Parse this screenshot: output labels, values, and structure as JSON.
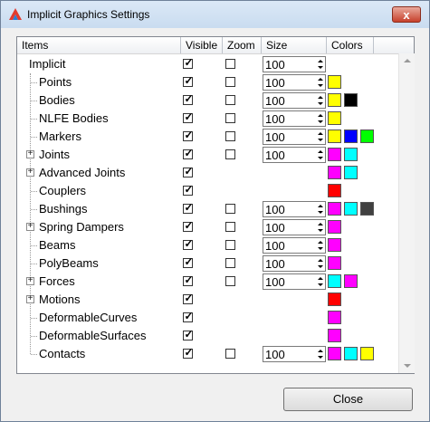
{
  "window": {
    "title": "Implicit Graphics Settings",
    "close_glyph": "x"
  },
  "columns": [
    "Items",
    "Visible",
    "Zoom",
    "Size",
    "Colors"
  ],
  "rows": [
    {
      "label": "Implicit",
      "indent": 0,
      "expandable": false,
      "visible": true,
      "zoom": false,
      "size": "100",
      "colors": []
    },
    {
      "label": "Points",
      "indent": 1,
      "expandable": false,
      "visible": true,
      "zoom": false,
      "size": "100",
      "colors": [
        "#ffff00"
      ]
    },
    {
      "label": "Bodies",
      "indent": 1,
      "expandable": false,
      "visible": true,
      "zoom": false,
      "size": "100",
      "colors": [
        "#ffff00",
        "#000000"
      ]
    },
    {
      "label": "NLFE Bodies",
      "indent": 1,
      "expandable": false,
      "visible": true,
      "zoom": false,
      "size": "100",
      "colors": [
        "#ffff00"
      ]
    },
    {
      "label": "Markers",
      "indent": 1,
      "expandable": false,
      "visible": true,
      "zoom": false,
      "size": "100",
      "colors": [
        "#ffff00",
        "#0000ff",
        "#00ff00"
      ]
    },
    {
      "label": "Joints",
      "indent": 1,
      "expandable": true,
      "visible": true,
      "zoom": false,
      "size": "100",
      "colors": [
        "#ff00ff",
        "#00ffff"
      ]
    },
    {
      "label": "Advanced Joints",
      "indent": 1,
      "expandable": true,
      "visible": true,
      "zoom": null,
      "size": null,
      "colors": [
        "#ff00ff",
        "#00ffff"
      ]
    },
    {
      "label": "Couplers",
      "indent": 1,
      "expandable": false,
      "visible": true,
      "zoom": null,
      "size": null,
      "colors": [
        "#ff0000"
      ]
    },
    {
      "label": "Bushings",
      "indent": 1,
      "expandable": false,
      "visible": true,
      "zoom": false,
      "size": "100",
      "colors": [
        "#ff00ff",
        "#00ffff",
        "#404040"
      ]
    },
    {
      "label": "Spring Dampers",
      "indent": 1,
      "expandable": true,
      "visible": true,
      "zoom": false,
      "size": "100",
      "colors": [
        "#ff00ff"
      ]
    },
    {
      "label": "Beams",
      "indent": 1,
      "expandable": false,
      "visible": true,
      "zoom": false,
      "size": "100",
      "colors": [
        "#ff00ff"
      ]
    },
    {
      "label": "PolyBeams",
      "indent": 1,
      "expandable": false,
      "visible": true,
      "zoom": false,
      "size": "100",
      "colors": [
        "#ff00ff"
      ]
    },
    {
      "label": "Forces",
      "indent": 1,
      "expandable": true,
      "visible": true,
      "zoom": false,
      "size": "100",
      "colors": [
        "#00ffff",
        "#ff00ff"
      ]
    },
    {
      "label": "Motions",
      "indent": 1,
      "expandable": true,
      "visible": true,
      "zoom": null,
      "size": null,
      "colors": [
        "#ff0000"
      ]
    },
    {
      "label": "DeformableCurves",
      "indent": 1,
      "expandable": false,
      "visible": true,
      "zoom": null,
      "size": null,
      "colors": [
        "#ff00ff"
      ]
    },
    {
      "label": "DeformableSurfaces",
      "indent": 1,
      "expandable": false,
      "visible": true,
      "zoom": null,
      "size": null,
      "colors": [
        "#ff00ff"
      ]
    },
    {
      "label": "Contacts",
      "indent": 1,
      "expandable": false,
      "visible": true,
      "zoom": false,
      "size": "100",
      "colors": [
        "#ff00ff",
        "#00ffff",
        "#ffff00"
      ]
    }
  ],
  "footer": {
    "close_label": "Close"
  }
}
